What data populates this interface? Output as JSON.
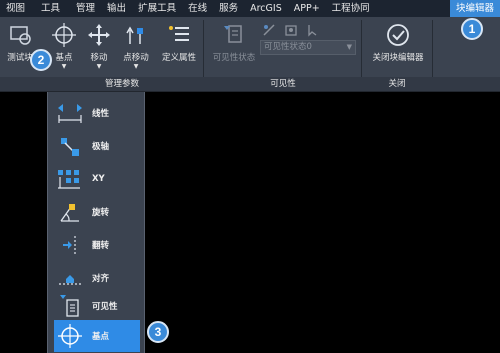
{
  "menubar": {
    "items": [
      "视图",
      "工具",
      "管理",
      "输出",
      "扩展工具",
      "在线",
      "服务",
      "ArcGIS",
      "APP+",
      "工程协同",
      "块编辑器"
    ],
    "active_index": 10
  },
  "ribbon": {
    "test_button": "测试块",
    "basepoint_button": "基点",
    "move_button": "移动",
    "pointmove_button": "点移动",
    "define_attr_button": "定义属性",
    "visibility_state_button": "可见性状态",
    "visibility_combo_value": "可见性状态0",
    "close_button": "关闭块编辑器",
    "panels": {
      "manage_params": "管理参数",
      "visibility": "可见性",
      "close": "关闭"
    }
  },
  "dropdown": {
    "items": [
      {
        "label": "线性",
        "icon": "linear-icon"
      },
      {
        "label": "极轴",
        "icon": "polar-icon"
      },
      {
        "label": "XY",
        "icon": "xy-icon"
      },
      {
        "label": "旋转",
        "icon": "rotate-icon"
      },
      {
        "label": "翻转",
        "icon": "flip-icon"
      },
      {
        "label": "对齐",
        "icon": "align-icon"
      },
      {
        "label": "可见性",
        "icon": "visibility-icon"
      },
      {
        "label": "基点",
        "icon": "basepoint-icon"
      }
    ],
    "selected_index": 7
  },
  "callouts": [
    "1",
    "2",
    "3"
  ],
  "colors": {
    "accent": "#3a8ad8",
    "selected": "#2f8be6",
    "ribbon_bg": "#3b4350",
    "menubar_bg": "#1c2430"
  }
}
